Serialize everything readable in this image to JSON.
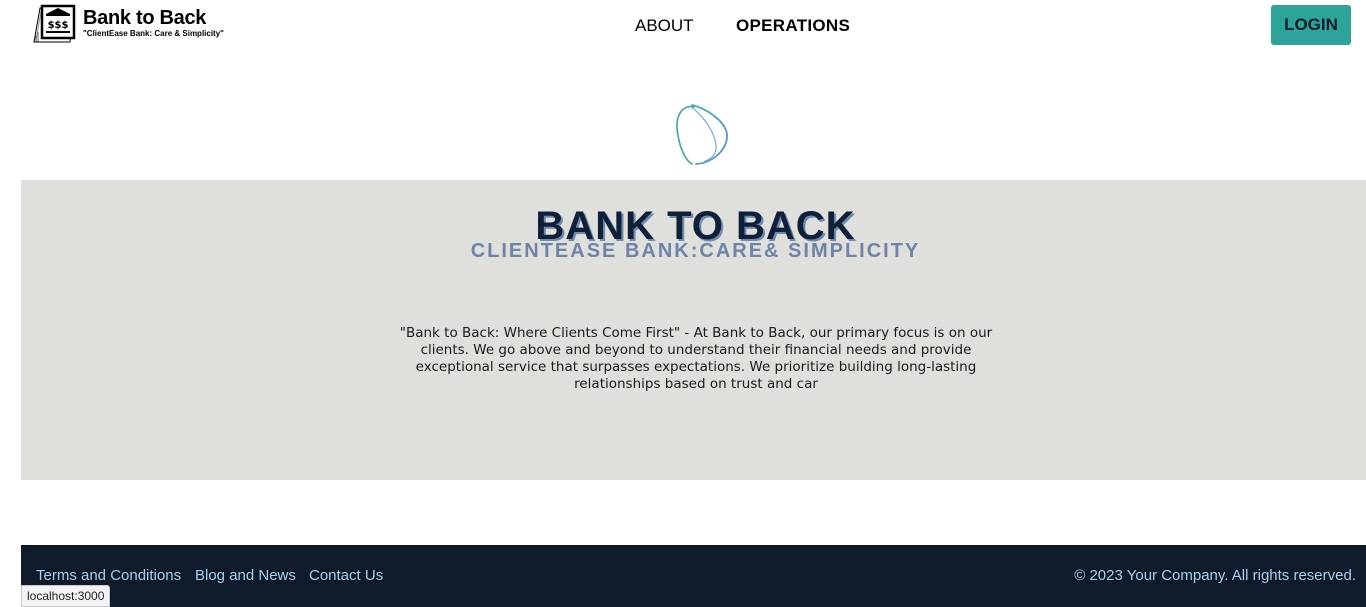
{
  "header": {
    "logo_title": "Bank to Back",
    "logo_tagline": "\"ClientEase Bank:  Care & Simplicity\"",
    "nav": [
      {
        "label": "ABOUT"
      },
      {
        "label": "OPERATIONS"
      }
    ],
    "login_label": "LOGIN",
    "accent_color": "#2ea39a"
  },
  "hero": {
    "title": "BANK TO BACK",
    "subtitle": "CLIENTEASE BANK:CARE& SIMPLICITY",
    "description": "\"Bank to Back: Where Clients Come First\" - At Bank to Back, our primary focus is on our clients. We go above and beyond to understand their financial needs and provide exceptional service that surpasses expectations. We prioritize building long-lasting relationships based on trust and car",
    "background_color": "#dfdfdb"
  },
  "footer": {
    "links": [
      {
        "label": "Terms and Conditions"
      },
      {
        "label": "Blog and News"
      },
      {
        "label": "Contact Us"
      }
    ],
    "copyright": "© 2023 Your Company. All rights reserved.",
    "background_color": "#0f1b2a"
  },
  "browser": {
    "status_url": "localhost:3000"
  },
  "icons": {
    "logo": "bank-building-dollar-icon",
    "loader": "spinner-icon"
  }
}
